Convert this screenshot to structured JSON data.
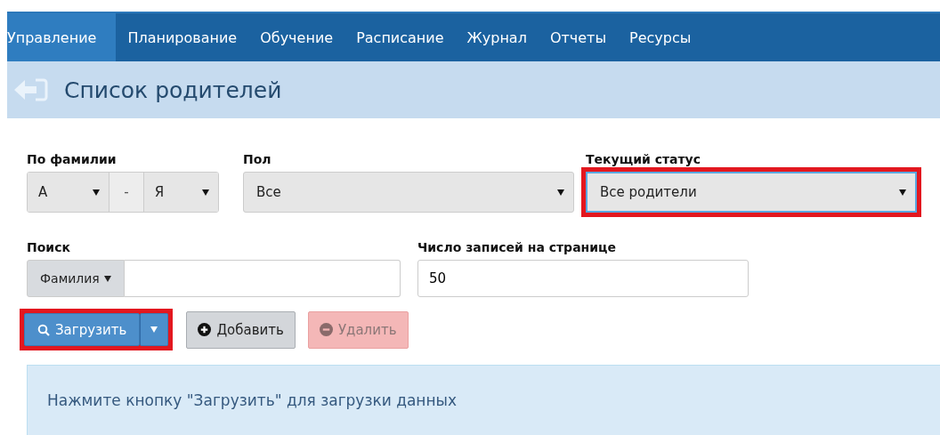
{
  "nav": {
    "tabs": [
      {
        "label": "Управление",
        "selected": true
      },
      {
        "label": "Планирование",
        "selected": false
      },
      {
        "label": "Обучение",
        "selected": false
      },
      {
        "label": "Расписание",
        "selected": false
      },
      {
        "label": "Журнал",
        "selected": false
      },
      {
        "label": "Отчеты",
        "selected": false
      },
      {
        "label": "Ресурсы",
        "selected": false
      }
    ]
  },
  "header": {
    "title": "Список родителей"
  },
  "filters": {
    "surname": {
      "label": "По фамилии",
      "from": "А",
      "separator": "-",
      "to": "Я"
    },
    "gender": {
      "label": "Пол",
      "value": "Все"
    },
    "status": {
      "label": "Текущий статус",
      "value": "Все родители",
      "highlighted": true
    },
    "search": {
      "label": "Поиск",
      "field_menu": "Фамилия"
    },
    "per_page": {
      "label": "Число записей на странице",
      "value": "50"
    }
  },
  "buttons": [
    {
      "kind": "split",
      "label": "Загрузить",
      "highlighted": true,
      "disabled": false
    },
    {
      "kind": "add",
      "label": "Добавить",
      "highlighted": false,
      "disabled": false
    },
    {
      "kind": "delete",
      "label": "Удалить",
      "highlighted": false,
      "disabled": true
    }
  ],
  "info": {
    "message": "Нажмите кнопку \"Загрузить\" для загрузки данных"
  }
}
